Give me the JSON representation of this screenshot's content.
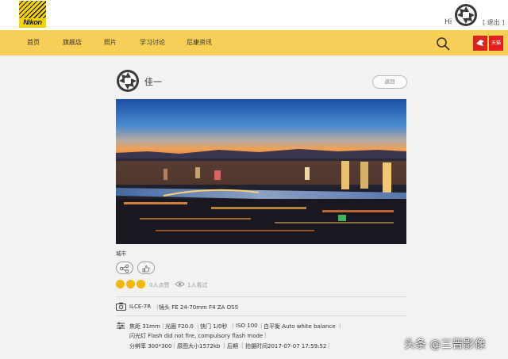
{
  "brand": {
    "logo_text": "Nikon",
    "accent": "#f6cf56"
  },
  "header": {
    "hi": "Hi",
    "logout": "[ 退出 ]"
  },
  "nav": {
    "items": [
      "首页",
      "旗舰店",
      "照片",
      "学习讨论",
      "尼康资讯"
    ]
  },
  "badges": [
    {
      "label": "",
      "color": "#d9231d"
    },
    {
      "label": "天猫",
      "color": "#e41e1e"
    }
  ],
  "post": {
    "author": "佳一",
    "back": "返回",
    "caption": "城市",
    "likes": "0人点赞",
    "views": "1人看过"
  },
  "exif": {
    "camera": "ILCE-7R",
    "lens": "镜头 FE 24-70mm F4 ZA OSS",
    "focal": "焦距 31mm",
    "aperture": "光圈 F20.0",
    "shutter": "快门 1/0秒",
    "iso": "ISO 100",
    "wb": "白平衡 Auto white balance",
    "flash": "闪光灯 Flash did not fire, compulsory flash mode",
    "resolution": "分辨率 300*300",
    "size": "原图大小1572kb",
    "post": "后期",
    "time": "拍摄时间2017-07-07 17:59:52"
  },
  "watermark": "头条 @三晋影像"
}
